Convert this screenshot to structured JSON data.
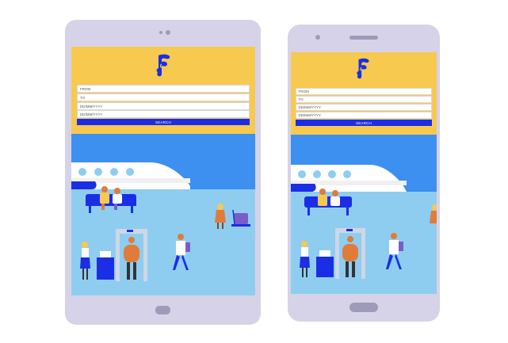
{
  "colors": {
    "frame": "#d6d3e8",
    "header": "#f7c94e",
    "accent": "#1b2ee6",
    "sky": "#3d8ff0",
    "floor": "#8ecdf0"
  },
  "tablet": {
    "logo_icon": "f-brand-logo-icon",
    "from_placeholder": "FROM",
    "to_placeholder": "TO",
    "depart_date": "DD/MM/YYYY",
    "return_date": "DD/MM/YYYY",
    "search_label": "SEARCH"
  },
  "phone": {
    "logo_icon": "f-brand-logo-icon",
    "from_placeholder": "FROM",
    "to_placeholder": "TO",
    "depart_date": "DD/MM/YYYY",
    "return_date": "DD/MM/YYYY",
    "search_label": "SEARCH"
  }
}
